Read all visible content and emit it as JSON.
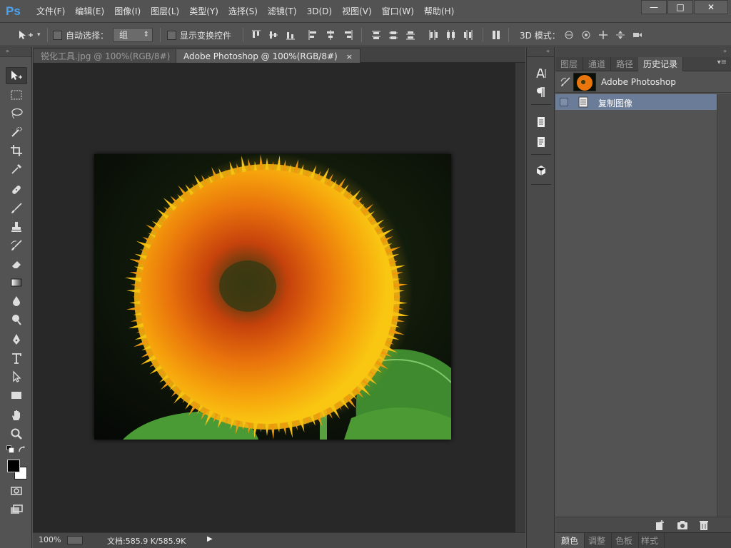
{
  "app": {
    "logo": "Ps"
  },
  "menu": [
    "文件(F)",
    "编辑(E)",
    "图像(I)",
    "图层(L)",
    "类型(Y)",
    "选择(S)",
    "滤镜(T)",
    "3D(D)",
    "视图(V)",
    "窗口(W)",
    "帮助(H)"
  ],
  "window_controls": {
    "minimize": "—",
    "maximize": "□",
    "close": "✕"
  },
  "options": {
    "auto_select_label": "自动选择：",
    "auto_select_value": "组",
    "show_transform_label": "显示变换控件",
    "mode_3d_label": "3D 模式："
  },
  "tabs": [
    {
      "label": "锐化工具.jpg @ 100%(RGB/8#)",
      "close": "×"
    },
    {
      "label": "Adobe Photoshop @ 100%(RGB/8#)",
      "close": "×"
    }
  ],
  "status": {
    "zoom": "100%",
    "doc_info": "文档:585.9 K/585.9K",
    "arrow": "▶"
  },
  "panel": {
    "tabs": [
      "图层",
      "通道",
      "路径",
      "历史记录"
    ],
    "menu_icon": "▾≡",
    "snapshot_label": "Adobe Photoshop",
    "history_item": "复制图像"
  },
  "color_panel_tabs": [
    "颜色",
    "调整",
    "色板",
    "样式"
  ],
  "colors": {
    "accent": "#4aa3f0",
    "selection": "#6a7c97",
    "canvas": "#282828",
    "ui": "#535353"
  }
}
